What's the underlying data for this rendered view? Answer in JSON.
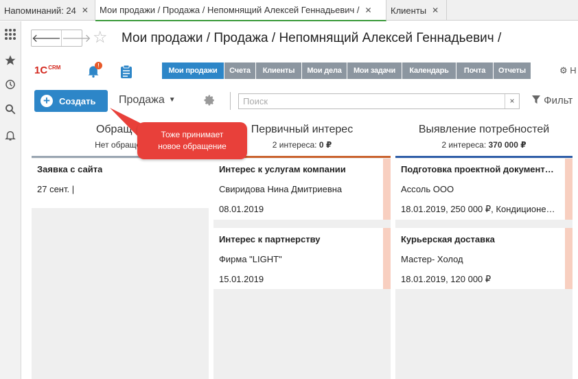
{
  "tabs": [
    {
      "label": "Напоминаний: 24",
      "close": "✕"
    },
    {
      "label": "Мои продажи / Продажа / Непомнящий Алексей Геннадьевич /",
      "close": "✕"
    },
    {
      "label": "Клиенты",
      "close": "✕"
    }
  ],
  "left_bar_icons": [
    "grid-icon",
    "star-icon",
    "history-icon",
    "search-icon",
    "bell-icon"
  ],
  "page": {
    "title": "Мои продажи / Продажа / Непомнящий Алексей Геннадьевич /"
  },
  "crm": {
    "logo": "1С",
    "logo_sub": "CRM",
    "notification_badge": "!",
    "nav": [
      {
        "label": "Мои продажи",
        "active": true
      },
      {
        "label": "Счета",
        "active": false
      },
      {
        "label": "Клиенты",
        "active": false
      },
      {
        "label": "Мои дела",
        "active": false
      },
      {
        "label": "Мои задачи",
        "active": false
      },
      {
        "label": "Календарь",
        "active": false
      },
      {
        "label": "Почта",
        "active": false
      },
      {
        "label": "Отчеты",
        "active": false
      }
    ],
    "settings_label": "Н"
  },
  "toolbar": {
    "create_label": "Создать",
    "sale_dropdown": "Продажа",
    "search_placeholder": "Поиск",
    "search_clear": "×",
    "filter_label": "Фильт"
  },
  "colors": {
    "accent": "#2d86c8",
    "nav_inactive": "#8c96a0",
    "callout": "#e8403a",
    "col_line_interest": "#c9622e",
    "col_line_needs": "#2f5ea8",
    "card_stripe": "#f8cfc0"
  },
  "callout": {
    "line1": "Тоже принимает",
    "line2": "новое обращение"
  },
  "columns": [
    {
      "name": "Обращен",
      "summary": "Нет обращен",
      "summary_value": "",
      "cards": [
        {
          "title": "Заявка с сайта",
          "line2": "27 сент. |",
          "line3": ""
        }
      ]
    },
    {
      "name": "Первичный интерес",
      "summary": "2 интереса:",
      "summary_value": "0 ₽",
      "cards": [
        {
          "title": "Интерес к услугам компании",
          "line2": "Свиридова Нина Дмитриевна",
          "line3": "08.01.2019"
        },
        {
          "title": "Интерес к партнерству",
          "line2": "Фирма \"LIGHT\"",
          "line3": "15.01.2019"
        }
      ]
    },
    {
      "name": "Выявление потребностей",
      "summary": "2 интереса:",
      "summary_value": "370 000 ₽",
      "cards": [
        {
          "title": "Подготовка проектной документ…",
          "line2": "Ассоль ООО",
          "line3": "18.01.2019, 250 000 ₽, Кондиционе…"
        },
        {
          "title": "Курьерская доставка",
          "line2": "Мастер- Холод",
          "line3": "18.01.2019, 120 000 ₽"
        }
      ]
    }
  ]
}
